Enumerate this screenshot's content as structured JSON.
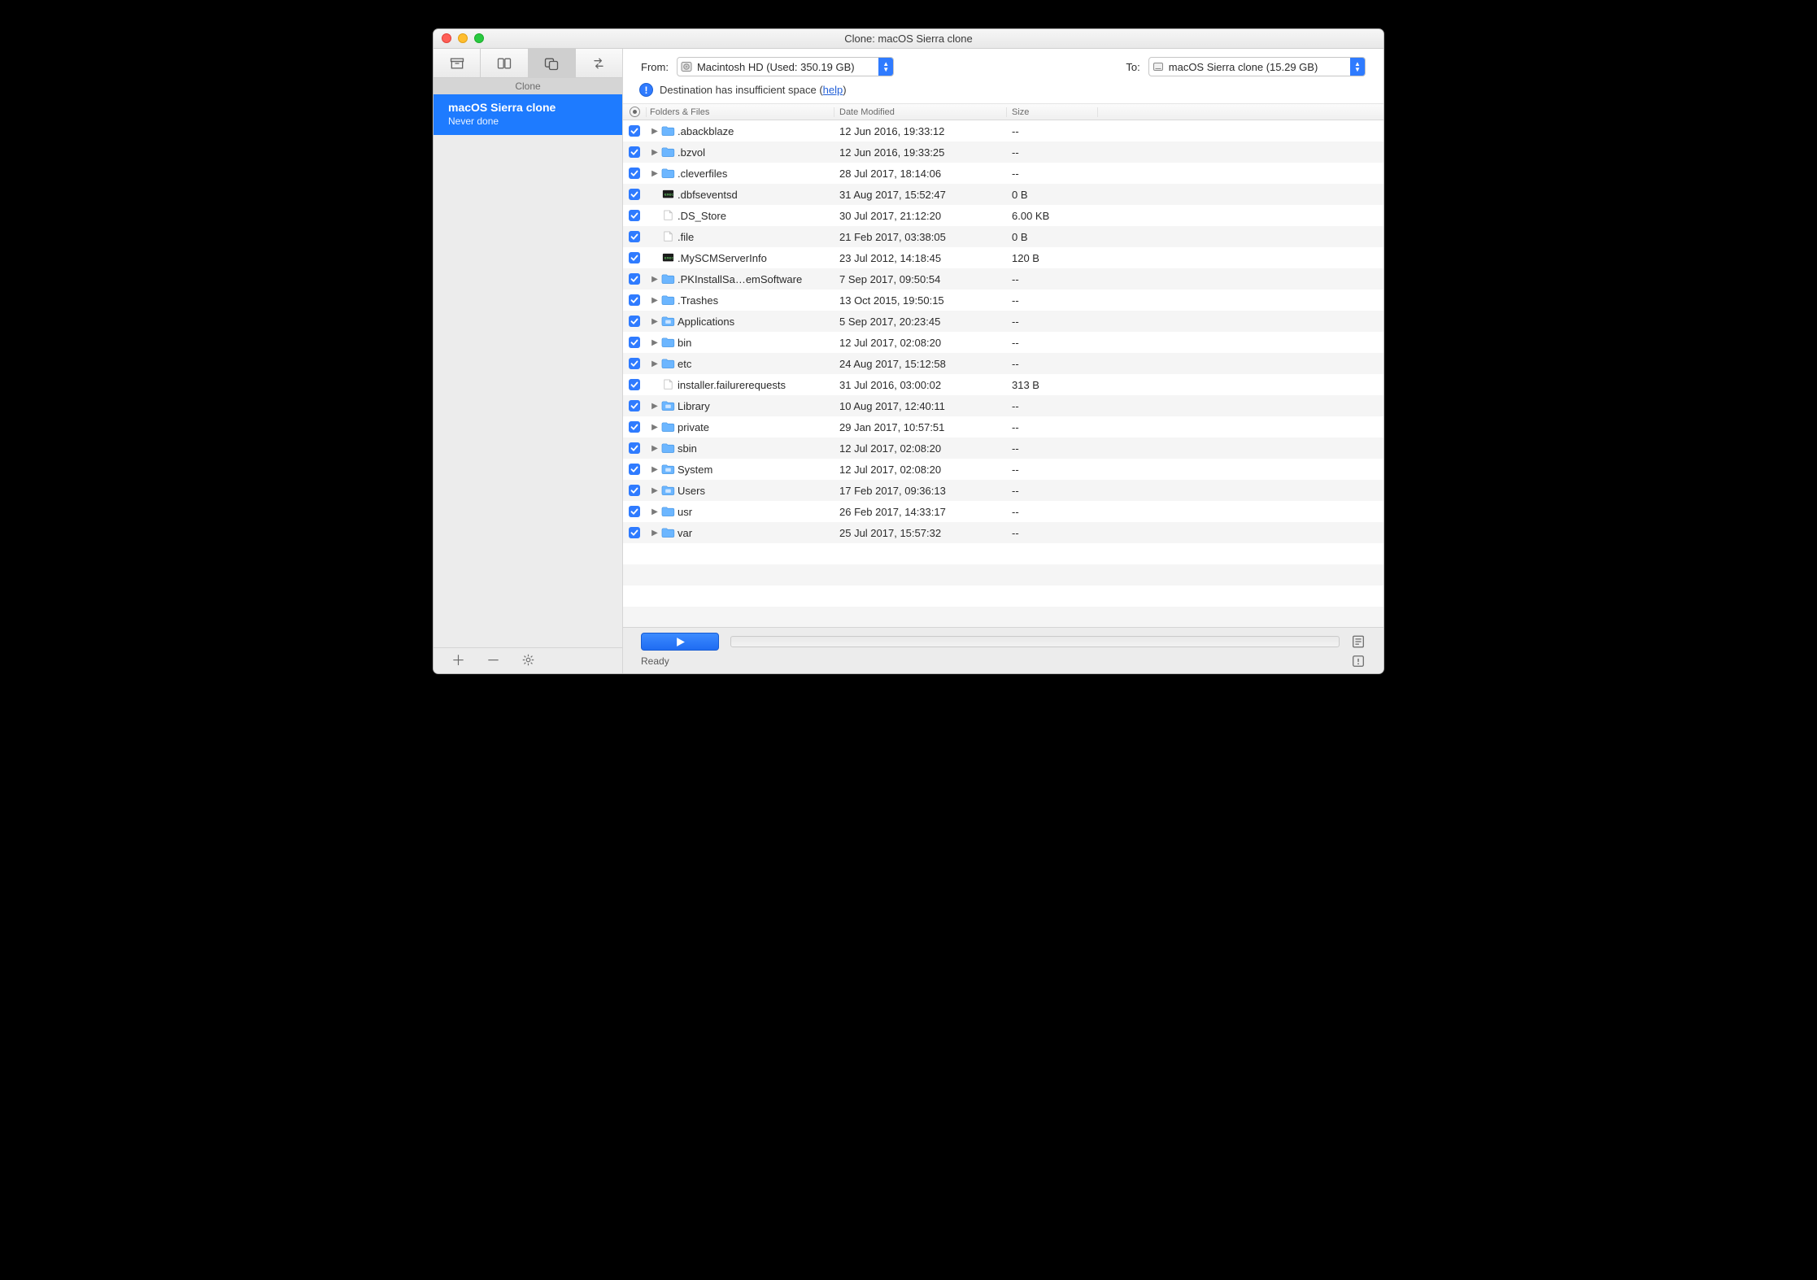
{
  "titlebar": {
    "title": "Clone: macOS Sierra clone"
  },
  "sidebar": {
    "heading": "Clone",
    "item": {
      "name": "macOS Sierra clone",
      "subtitle": "Never done"
    }
  },
  "selectors": {
    "from_label": "From:",
    "from_value": "Macintosh HD (Used: 350.19 GB)",
    "to_label": "To:",
    "to_value": "macOS Sierra clone (15.29 GB)"
  },
  "info": {
    "text_prefix": "Destination has insufficient space (",
    "help_label": "help",
    "text_suffix": ")"
  },
  "table": {
    "headers": {
      "name": "Folders & Files",
      "date": "Date Modified",
      "size": "Size"
    },
    "rows": [
      {
        "checked": true,
        "expandable": true,
        "icon": "folder",
        "name": ".abackblaze",
        "date": "12 Jun 2016, 19:33:12",
        "size": "--"
      },
      {
        "checked": true,
        "expandable": true,
        "icon": "folder",
        "name": ".bzvol",
        "date": "12 Jun 2016, 19:33:25",
        "size": "--"
      },
      {
        "checked": true,
        "expandable": true,
        "icon": "folder",
        "name": ".cleverfiles",
        "date": "28 Jul 2017, 18:14:06",
        "size": "--"
      },
      {
        "checked": true,
        "expandable": false,
        "icon": "exec",
        "name": ".dbfseventsd",
        "date": "31 Aug 2017, 15:52:47",
        "size": "0 B"
      },
      {
        "checked": true,
        "expandable": false,
        "icon": "file",
        "name": ".DS_Store",
        "date": "30 Jul 2017, 21:12:20",
        "size": "6.00 KB"
      },
      {
        "checked": true,
        "expandable": false,
        "icon": "file",
        "name": ".file",
        "date": "21 Feb 2017, 03:38:05",
        "size": "0 B"
      },
      {
        "checked": true,
        "expandable": false,
        "icon": "exec",
        "name": ".MySCMServerInfo",
        "date": "23 Jul 2012, 14:18:45",
        "size": "120 B"
      },
      {
        "checked": true,
        "expandable": true,
        "icon": "folder",
        "name": ".PKInstallSa…emSoftware",
        "date": "7 Sep 2017, 09:50:54",
        "size": "--"
      },
      {
        "checked": true,
        "expandable": true,
        "icon": "folder",
        "name": ".Trashes",
        "date": "13 Oct 2015, 19:50:15",
        "size": "--"
      },
      {
        "checked": true,
        "expandable": true,
        "icon": "folder-apps",
        "name": "Applications",
        "date": "5 Sep 2017, 20:23:45",
        "size": "--"
      },
      {
        "checked": true,
        "expandable": true,
        "icon": "folder",
        "name": "bin",
        "date": "12 Jul 2017, 02:08:20",
        "size": "--"
      },
      {
        "checked": true,
        "expandable": true,
        "icon": "folder",
        "name": "etc",
        "date": "24 Aug 2017, 15:12:58",
        "size": "--"
      },
      {
        "checked": true,
        "expandable": false,
        "icon": "file",
        "name": "installer.failurerequests",
        "date": "31 Jul 2016, 03:00:02",
        "size": "313 B"
      },
      {
        "checked": true,
        "expandable": true,
        "icon": "folder-lib",
        "name": "Library",
        "date": "10 Aug 2017, 12:40:11",
        "size": "--"
      },
      {
        "checked": true,
        "expandable": true,
        "icon": "folder",
        "name": "private",
        "date": "29 Jan 2017, 10:57:51",
        "size": "--"
      },
      {
        "checked": true,
        "expandable": true,
        "icon": "folder",
        "name": "sbin",
        "date": "12 Jul 2017, 02:08:20",
        "size": "--"
      },
      {
        "checked": true,
        "expandable": true,
        "icon": "folder-sys",
        "name": "System",
        "date": "12 Jul 2017, 02:08:20",
        "size": "--"
      },
      {
        "checked": true,
        "expandable": true,
        "icon": "folder-users",
        "name": "Users",
        "date": "17 Feb 2017, 09:36:13",
        "size": "--"
      },
      {
        "checked": true,
        "expandable": true,
        "icon": "folder",
        "name": "usr",
        "date": "26 Feb 2017, 14:33:17",
        "size": "--"
      },
      {
        "checked": true,
        "expandable": true,
        "icon": "folder",
        "name": "var",
        "date": "25 Jul 2017, 15:57:32",
        "size": "--"
      }
    ]
  },
  "footer": {
    "status": "Ready"
  }
}
